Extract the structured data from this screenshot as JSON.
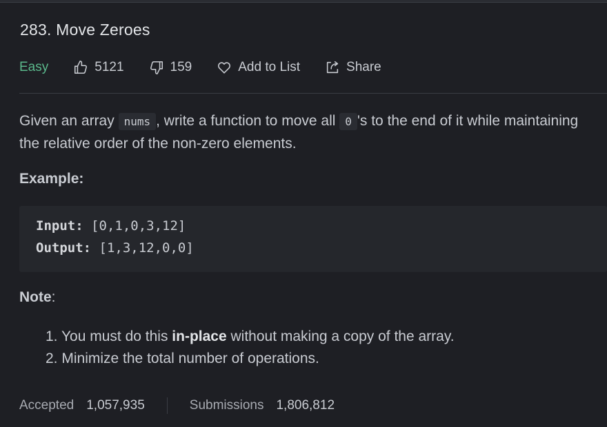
{
  "problem": {
    "title": "283. Move Zeroes",
    "difficulty": "Easy",
    "likes": "5121",
    "dislikes": "159",
    "add_to_list_label": "Add to List",
    "share_label": "Share"
  },
  "description": {
    "part1": "Given an array ",
    "code1": "nums",
    "part2": ", write a function to move all ",
    "code2": "0",
    "part3": "'s to the end of it while maintaining the relative order of the non-zero elements."
  },
  "example": {
    "heading": "Example:",
    "input_label": "Input:",
    "input_value": " [0,1,0,3,12]",
    "output_label": "Output:",
    "output_value": " [1,3,12,0,0]"
  },
  "note": {
    "heading": "Note",
    "colon": ":",
    "items": [
      {
        "number": "1. ",
        "before": "You must do this ",
        "bold": "in-place",
        "after": " without making a copy of the array."
      },
      {
        "number": "2. ",
        "text": "Minimize the total number of operations."
      }
    ]
  },
  "stats": {
    "accepted_label": "Accepted",
    "accepted_value": "1,057,935",
    "submissions_label": "Submissions",
    "submissions_value": "1,806,812"
  },
  "colors": {
    "background": "#1e1f24",
    "easy": "#5bb98c",
    "code_block_bg": "#25272c"
  }
}
